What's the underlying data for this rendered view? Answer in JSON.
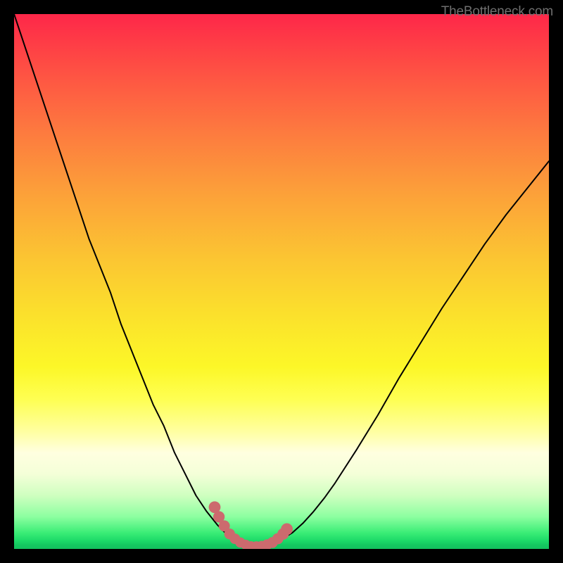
{
  "watermark_text": "TheBottleneck.com",
  "colors": {
    "background": "#000000",
    "curve": "#000000",
    "markers": "#cc6a6e",
    "watermark": "#6f6f6f"
  },
  "chart_data": {
    "type": "line",
    "title": "",
    "xlabel": "",
    "ylabel": "",
    "xlim": [
      0,
      100
    ],
    "ylim": [
      0,
      100
    ],
    "x": [
      0,
      2,
      4,
      6,
      8,
      10,
      12,
      14,
      16,
      18,
      20,
      22,
      24,
      26,
      28,
      30,
      32,
      34,
      36,
      38,
      40,
      41,
      42,
      43,
      44,
      45,
      46,
      47,
      48,
      49,
      50,
      52,
      54,
      56,
      58,
      60,
      64,
      68,
      72,
      76,
      80,
      84,
      88,
      92,
      96,
      100
    ],
    "y": [
      100,
      94,
      88,
      82,
      76,
      70,
      64,
      58,
      53,
      48,
      42,
      37,
      32,
      27,
      23,
      18,
      14,
      10,
      7,
      4.5,
      2.5,
      1.8,
      1.2,
      0.8,
      0.6,
      0.5,
      0.5,
      0.6,
      0.9,
      1.3,
      1.8,
      3,
      4.8,
      7,
      9.5,
      12.3,
      18.5,
      25,
      32,
      38.5,
      45,
      51,
      57,
      62.5,
      67.5,
      72.5
    ],
    "markers": {
      "x": [
        37.5,
        38.3,
        39.3,
        40.3,
        41.3,
        42.3,
        43.3,
        44.3,
        45.3,
        46.3,
        47.3,
        48.3,
        49.3,
        50.3,
        51
      ],
      "y": [
        7.8,
        6.0,
        4.3,
        2.8,
        1.9,
        1.2,
        0.8,
        0.55,
        0.5,
        0.55,
        0.8,
        1.2,
        1.9,
        2.8,
        3.7
      ]
    }
  }
}
